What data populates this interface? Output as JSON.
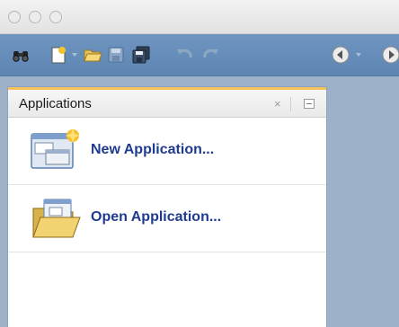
{
  "panel": {
    "title": "Applications",
    "close_glyph": "×"
  },
  "items": [
    {
      "label": "New Application...",
      "icon": "new-application-icon"
    },
    {
      "label": "Open Application...",
      "icon": "open-application-icon"
    }
  ],
  "toolbar_icons": [
    "binoculars-icon",
    "new-file-icon",
    "open-folder-icon",
    "save-icon",
    "save-all-icon",
    "undo-icon",
    "redo-icon",
    "back-icon",
    "forward-icon"
  ],
  "colors": {
    "toolbar": "#5e86b3",
    "background": "#9db2c9",
    "link": "#1f3b8f",
    "tab_accent": "#f3c25a"
  }
}
